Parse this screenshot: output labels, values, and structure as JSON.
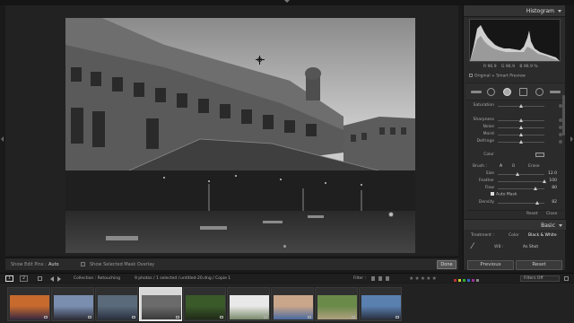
{
  "right_panel": {
    "histogram_title": "Histogram",
    "readout": {
      "r": "R 96.9",
      "g": "G 96.9",
      "b": "B 96.9 %"
    },
    "preview_label": "Original + Smart Preview",
    "sliders": [
      {
        "label": "Saturation",
        "value": ""
      },
      {
        "label": "Sharpness",
        "value": ""
      },
      {
        "label": "Noise",
        "value": ""
      },
      {
        "label": "Moiré",
        "value": ""
      },
      {
        "label": "Defringe",
        "value": ""
      }
    ],
    "color_label": "Color",
    "brush": {
      "label": "Brush :",
      "a": "A",
      "b": "B",
      "erase": "Erase"
    },
    "brush_sliders": [
      {
        "label": "Size",
        "value": "12.0"
      },
      {
        "label": "Feather",
        "value": "100"
      },
      {
        "label": "Flow",
        "value": "80"
      },
      {
        "label": "Density",
        "value": "82"
      }
    ],
    "auto_mask": "Auto Mask",
    "reset": "Reset",
    "close": "Close",
    "basic_title": "Basic",
    "treatment_label": "Treatment :",
    "treatment_color": "Color",
    "treatment_bw": "Black & White",
    "wb_label": "WB :",
    "wb_value": "As Shot",
    "previous": "Previous",
    "reset_btn": "Reset"
  },
  "toolbar": {
    "show_edit_pins": "Show Edit Pins :",
    "edit_pins_value": "Auto",
    "show_mask_overlay": "Show Selected Mask Overlay",
    "done": "Done"
  },
  "film_bar": {
    "num1": "1",
    "num2": "2",
    "collection": "Collection : Retouching",
    "selection_info": "9 photos / 1 selected /",
    "file": "untitled-20.dng / Copie 1",
    "filter_label": "Filter :",
    "filter_value": "Filters Off"
  },
  "filmstrip": {
    "selected_index": 3,
    "thumbs": [
      {
        "colors": [
          "#c66a2e",
          "#3a2a40"
        ]
      },
      {
        "colors": [
          "#7a8fb0",
          "#2d2d3a"
        ]
      },
      {
        "colors": [
          "#5a6a7a",
          "#2a3040"
        ]
      },
      {
        "colors": [
          "#6b6b6b",
          "#3a3a3a"
        ]
      },
      {
        "colors": [
          "#3b5a2a",
          "#1f2a18"
        ]
      },
      {
        "colors": [
          "#e8e8e8",
          "#7a8a6a"
        ]
      },
      {
        "colors": [
          "#c9a68a",
          "#4a6aa0"
        ]
      },
      {
        "colors": [
          "#6a8a4a",
          "#b0a080"
        ]
      },
      {
        "colors": [
          "#5a80b0",
          "#2a3040"
        ]
      }
    ]
  }
}
